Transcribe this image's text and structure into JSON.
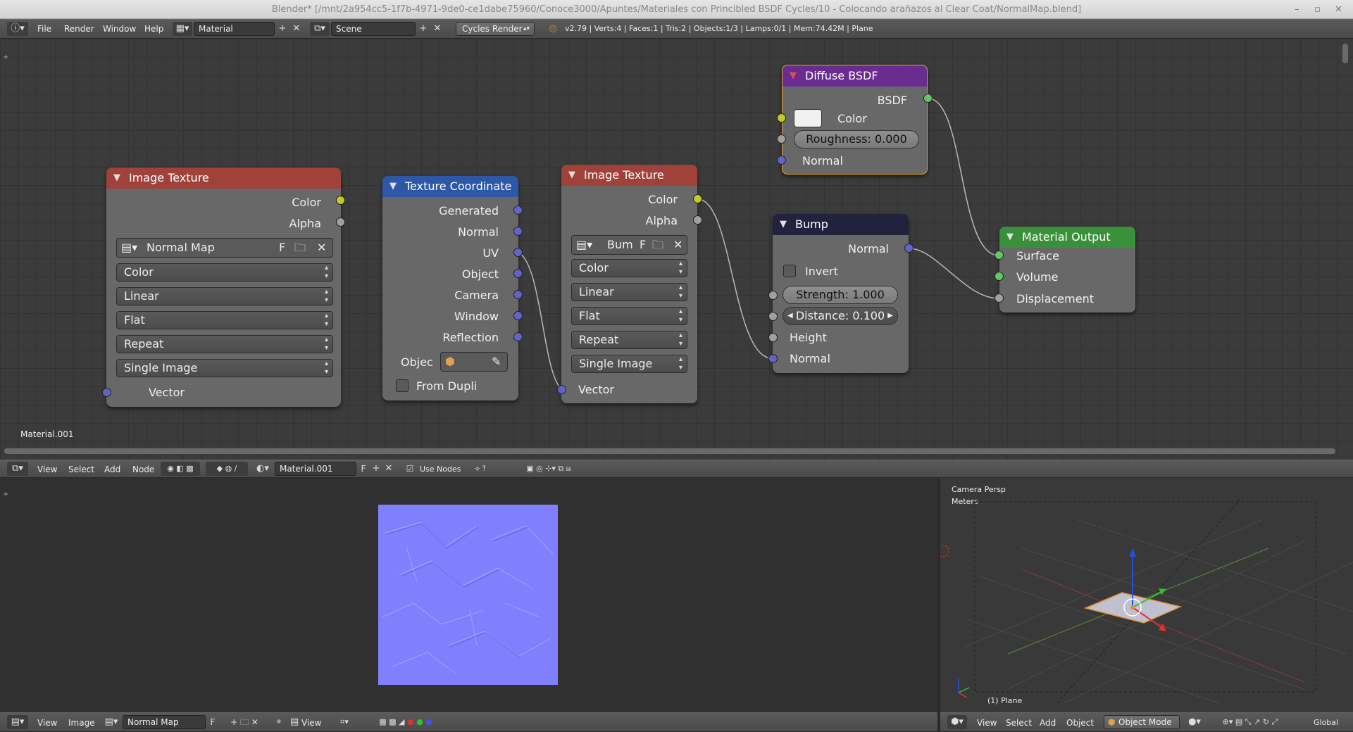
{
  "window": {
    "title": "Blender* [/mnt/2a954cc5-1f7b-4971-9de0-ce1dabe75960/Conoce3000/Apuntes/Materiales con Princibled BSDF Cycles/10 - Colocando arañazos al Clear Coat/NormalMap.blend]"
  },
  "info_header": {
    "menus": [
      "File",
      "Render",
      "Window",
      "Help"
    ],
    "screen_layout": "Material",
    "scene": "Scene",
    "render_engine": "Cycles Render",
    "stats": "v2.79 | Verts:4 | Faces:1 | Tris:2 | Objects:1/3 | Lamps:0/1 | Mem:74.42M | Plane"
  },
  "node_editor": {
    "material_label": "Material.001",
    "nodes": {
      "image_texture_1": {
        "title": "Image Texture",
        "out_color": "Color",
        "out_alpha": "Alpha",
        "image_name": "Normal Map",
        "fake_user": "F",
        "color_space": "Color",
        "interpolation": "Linear",
        "projection": "Flat",
        "extension": "Repeat",
        "source": "Single Image",
        "in_vector": "Vector"
      },
      "texture_coordinate": {
        "title": "Texture Coordinate",
        "outputs": [
          "Generated",
          "Normal",
          "UV",
          "Object",
          "Camera",
          "Window",
          "Reflection"
        ],
        "object_label": "Objec",
        "from_dupli": "From Dupli"
      },
      "image_texture_2": {
        "title": "Image Texture",
        "out_color": "Color",
        "out_alpha": "Alpha",
        "image_name": "Bum",
        "fake_user": "F",
        "color_space": "Color",
        "interpolation": "Linear",
        "projection": "Flat",
        "extension": "Repeat",
        "source": "Single Image",
        "in_vector": "Vector"
      },
      "diffuse_bsdf": {
        "title": "Diffuse BSDF",
        "out_bsdf": "BSDF",
        "in_color": "Color",
        "roughness_label": "Roughness:",
        "roughness_value": "0.000",
        "in_normal": "Normal",
        "color_swatch": "#f0f0f0"
      },
      "bump": {
        "title": "Bump",
        "out_normal": "Normal",
        "invert": "Invert",
        "strength_label": "Strength:",
        "strength_value": "1.000",
        "distance_label": "Distance:",
        "distance_value": "0.100",
        "in_height": "Height",
        "in_normal": "Normal"
      },
      "material_output": {
        "title": "Material Output",
        "in_surface": "Surface",
        "in_volume": "Volume",
        "in_displacement": "Displacement"
      }
    }
  },
  "node_header": {
    "menus": [
      "View",
      "Select",
      "Add",
      "Node"
    ],
    "material": "Material.001",
    "fake_user": "F",
    "use_nodes": "Use Nodes"
  },
  "image_editor": {
    "menus": [
      "View",
      "Image"
    ],
    "image": "Normal Map",
    "fake_user": "F",
    "view_menu": "View"
  },
  "viewport": {
    "label": "Camera Persp",
    "units": "Meters",
    "object": "(1) Plane",
    "menus": [
      "View",
      "Select",
      "Add",
      "Object"
    ],
    "mode": "Object Mode",
    "orientation": "Global"
  },
  "colors": {
    "header_image": "#a0413a",
    "header_texcoord": "#2d58a8",
    "header_diffuse": "#6a2c8f",
    "header_bump": "#22223f",
    "header_output": "#3a8f3a",
    "normal_map_blue": "#8080ff",
    "socket_color": "#c7c729",
    "socket_vector": "#6363c7",
    "socket_shader": "#63c763",
    "socket_float": "#a0a0a0"
  }
}
